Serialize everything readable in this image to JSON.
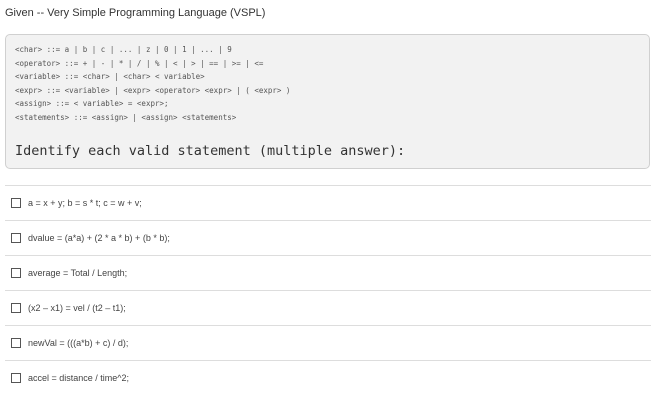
{
  "question": {
    "title": "Given -- Very Simple Programming Language (VSPL)",
    "grammar_lines": [
      "<char> ::= a | b | c | ... | z | 0 | 1 | ... | 9",
      "<operator> ::= + | - | * | / | % | < | > | == | >= | <=",
      "<variable> ::= <char> | <char> < variable>",
      "<expr> ::= <variable> | <expr> <operator> <expr> | ( <expr> )",
      "<assign> ::= < variable> = <expr>;",
      "<statements> ::= <assign> | <assign> <statements>"
    ],
    "prompt": "Identify each valid statement (multiple answer):"
  },
  "options": [
    {
      "label": "a = x + y; b = s * t; c = w + v;",
      "checked": false
    },
    {
      "label": "dvalue = (a*a) + (2 * a * b) + (b * b);",
      "checked": false
    },
    {
      "label": "average = Total / Length;",
      "checked": false
    },
    {
      "label": "(x2 – x1) = vel / (t2 – t1);",
      "checked": false
    },
    {
      "label": "newVal = (((a*b) + c) / d);",
      "checked": false
    },
    {
      "label": "accel = distance / time^2;",
      "checked": false
    }
  ]
}
